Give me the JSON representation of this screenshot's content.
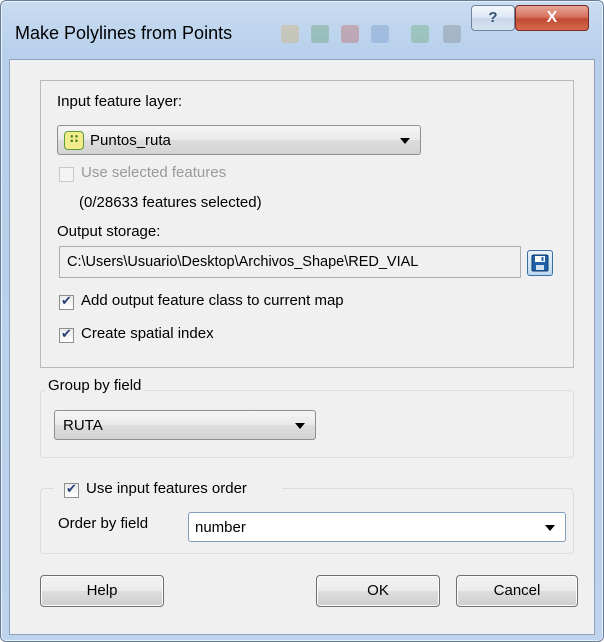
{
  "window": {
    "title": "Make Polylines from Points",
    "help_glyph": "?",
    "close_glyph": "X"
  },
  "input": {
    "label": "Input feature layer:",
    "layer_value": "Puntos_ruta",
    "layer_icon": "point-layer-icon",
    "use_selected_label": "Use selected features",
    "use_selected_checked": false,
    "use_selected_enabled": false,
    "selection_count": "(0/28633 features selected)"
  },
  "output": {
    "label": "Output storage:",
    "path": "C:\\Users\\Usuario\\Desktop\\Archivos_Shape\\RED_VIAL",
    "save_icon": "save-icon"
  },
  "options": {
    "add_to_map_label": "Add output feature class to current map",
    "add_to_map_checked": true,
    "spatial_index_label": "Create spatial index",
    "spatial_index_checked": true
  },
  "group_by": {
    "title": "Group by field",
    "value": "RUTA"
  },
  "order": {
    "use_order_label": "Use input features order",
    "use_order_checked": true,
    "order_by_label": "Order by field",
    "order_by_value": "number"
  },
  "buttons": {
    "help": "Help",
    "ok": "OK",
    "cancel": "Cancel"
  },
  "colors": {
    "title_bar": "#c2d7ef",
    "close_button": "#c24a32",
    "client_bg": "#f0f0f0",
    "check_mark": "#263e7a"
  }
}
